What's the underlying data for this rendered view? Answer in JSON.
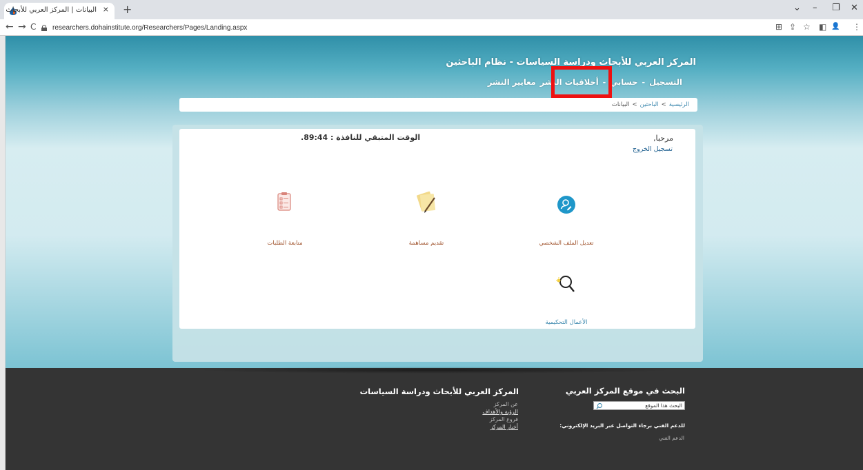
{
  "browser": {
    "tab_title": "البيانات | المركز العربي للأبحاث",
    "tab_close": "×",
    "new_tab": "+",
    "url": "researchers.dohainstitute.org/Researchers/Pages/Landing.aspx",
    "nav": {
      "back": "←",
      "forward": "→",
      "reload": "C"
    },
    "window": {
      "dropdown": "⌄",
      "minimize": "–",
      "restore": "❐",
      "close": "✕"
    },
    "extensions": {
      "translate": "⊞",
      "share": "⇪",
      "bookmark": "☆",
      "sidebar": "◧",
      "profile": "👤",
      "menu": "⋮"
    }
  },
  "header": {
    "site_title": "المركز العربي للأبحاث ودراسة السياسات - نظام الباحثين",
    "nav": [
      {
        "label": "التسجيل"
      },
      {
        "label": "حسابي"
      },
      {
        "label": "أخلاقيات النشر"
      },
      {
        "label": "معايير النشر"
      }
    ],
    "nav_separator": "-"
  },
  "breadcrumb": {
    "items": [
      "الرئيسية",
      "الباحثين",
      "البيانات"
    ],
    "separator": ">"
  },
  "user_panel": {
    "greeting": "مرحبا,",
    "logout": "تسجيل الخروج",
    "timer_label": "الوقت المتبقي للنافذة :",
    "timer_value": "89:44."
  },
  "tiles": [
    {
      "label": "تعديل الملف الشخصي",
      "icon": "profile-edit-icon"
    },
    {
      "label": "تقديم مساهمة",
      "icon": "notes-pencil-icon"
    },
    {
      "label": "متابعة الطلبات",
      "icon": "clipboard-checklist-icon"
    },
    {
      "label": "الأعمال التحكيمية",
      "icon": "magnifier-icon"
    }
  ],
  "footer": {
    "search_heading": "البحث في موقع المركز العربي",
    "search_placeholder": "البحث هذا الموقع",
    "support_text": "للدعم الفني برجاء التواصل عبر البريد الإلكتروني:",
    "support_link": "الدعم الفني",
    "center_heading": "المركز العربي للأبحاث ودراسة السياسات",
    "center_links": [
      {
        "label": "عن المركز",
        "underline": false
      },
      {
        "label": "الرؤية والأهداف",
        "underline": true
      },
      {
        "label": "فروع المركز",
        "underline": false
      },
      {
        "label": "أخبار المركز",
        "underline": true
      }
    ]
  },
  "colors": {
    "highlight": "#ee1111",
    "tile_label": "#a0542e",
    "footer_bg": "#343434",
    "profile_icon": "#1f97c9"
  }
}
